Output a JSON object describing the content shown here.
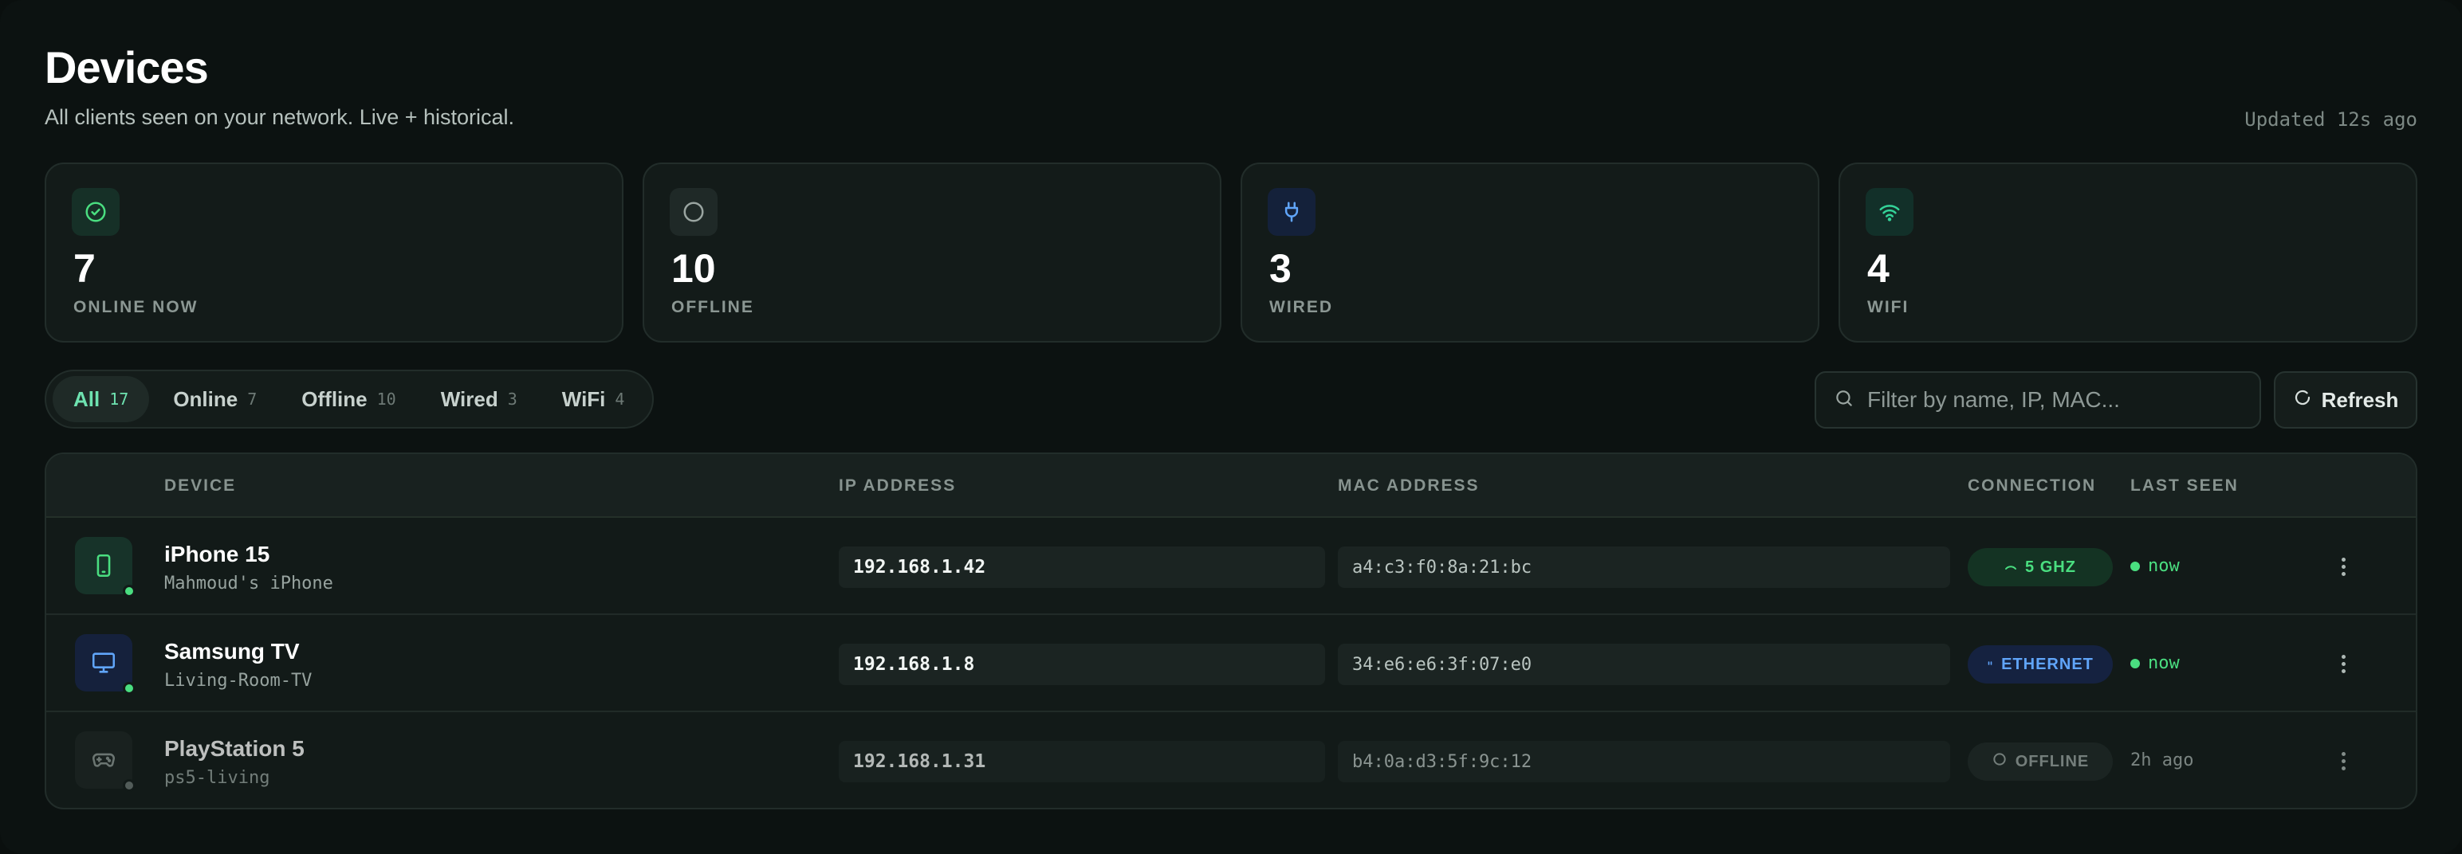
{
  "header": {
    "title": "Devices",
    "subtitle": "All clients seen on your network. Live + historical.",
    "updated": "Updated 12s ago"
  },
  "stats": [
    {
      "value": "7",
      "label": "ONLINE NOW",
      "icon": "check-circle-icon",
      "color": "#4ade80"
    },
    {
      "value": "10",
      "label": "OFFLINE",
      "icon": "empty-circle-icon",
      "color": "#9aa5a1"
    },
    {
      "value": "3",
      "label": "WIRED",
      "icon": "plug-icon",
      "color": "#60a5fa"
    },
    {
      "value": "4",
      "label": "WIFI",
      "icon": "wifi-icon",
      "color": "#34d399"
    }
  ],
  "filters": {
    "tabs": [
      {
        "label": "All",
        "count": "17"
      },
      {
        "label": "Online",
        "count": "7"
      },
      {
        "label": "Offline",
        "count": "10"
      },
      {
        "label": "Wired",
        "count": "3"
      },
      {
        "label": "WiFi",
        "count": "4"
      }
    ],
    "active": "All",
    "search_placeholder": "Filter by name, IP, MAC...",
    "refresh_label": "Refresh"
  },
  "table": {
    "columns": {
      "device": "DEVICE",
      "ip": "IP ADDRESS",
      "mac": "MAC ADDRESS",
      "connection": "CONNECTION",
      "last_seen": "LAST SEEN"
    },
    "rows": [
      {
        "name": "iPhone 15",
        "host": "Mahmoud's iPhone",
        "ip": "192.168.1.42",
        "mac": "a4:c3:f0:8a:21:bc",
        "connection": "5 GHZ",
        "last_seen": "now",
        "icon": "phone-icon",
        "status": "online"
      },
      {
        "name": "Samsung TV",
        "host": "Living-Room-TV",
        "ip": "192.168.1.8",
        "mac": "34:e6:e6:3f:07:e0",
        "connection": "ETHERNET",
        "last_seen": "now",
        "icon": "monitor-icon",
        "status": "online"
      },
      {
        "name": "PlayStation 5",
        "host": "ps5-living",
        "ip": "192.168.1.31",
        "mac": "b4:0a:d3:5f:9c:12",
        "connection": "OFFLINE",
        "last_seen": "2h ago",
        "icon": "gamepad-icon",
        "status": "offline"
      }
    ]
  },
  "colors": {
    "accent": "#6ee2b0",
    "online": "#4ade80",
    "wired": "#60a5fa",
    "offline": "#6b7673"
  }
}
